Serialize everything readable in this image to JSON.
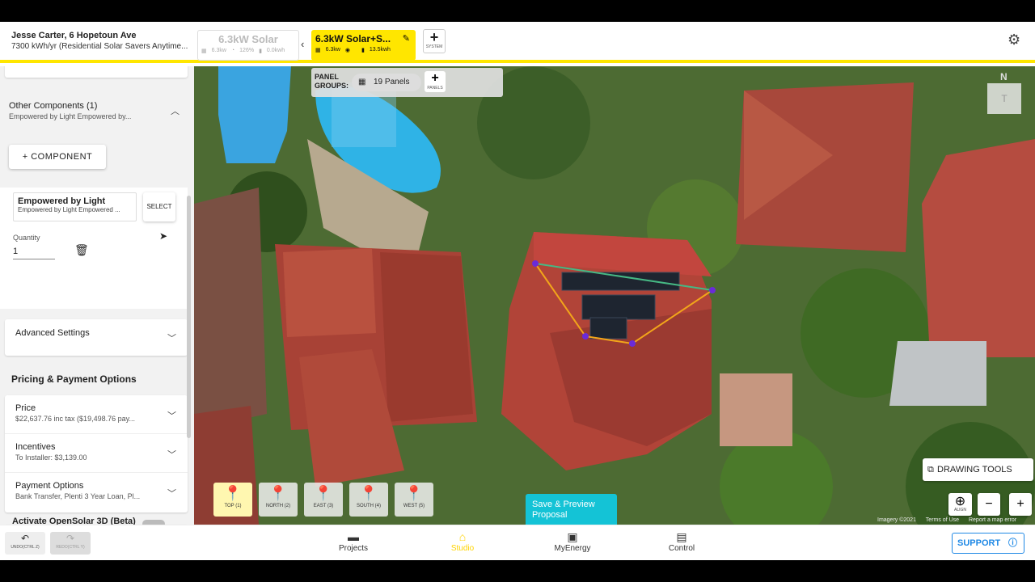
{
  "header": {
    "customer_name": "Jesse Carter, 6 Hopetoun Ave",
    "customer_usage": "7300 kWh/yr (Residential Solar Savers Anytime...",
    "system_tabs": [
      {
        "title": "6.3kW Solar",
        "stat1": "6.3kw",
        "stat2": "126%",
        "stat3": "0.0kwh"
      },
      {
        "title": "6.3kW Solar+S...",
        "stat1": "6.3kw",
        "stat2": "",
        "stat3": "13.5kwh"
      }
    ],
    "add_system_label": "SYSTEM"
  },
  "sidebar": {
    "other_components": {
      "title": "Other Components (1)",
      "subtitle": "Empowered by Light Empowered by..."
    },
    "add_component_label": "+ COMPONENT",
    "component": {
      "name": "Empowered by Light",
      "desc": "Empowered by Light Empowered ...",
      "select_label": "SELECT",
      "quantity_label": "Quantity",
      "quantity_value": "1"
    },
    "advanced_settings_label": "Advanced Settings",
    "pricing_heading": "Pricing & Payment Options",
    "price": {
      "title": "Price",
      "value": "$22,637.76 inc tax ($19,498.76 pay..."
    },
    "incentives": {
      "title": "Incentives",
      "value": "To Installer: $3,139.00"
    },
    "payment": {
      "title": "Payment Options",
      "value": "Bank Transfer, Plenti 3 Year Loan, Pl..."
    },
    "opensolar_3d_label": "Activate OpenSolar 3D (Beta)"
  },
  "map": {
    "panel_groups_label": "PANEL GROUPS:",
    "panels_chip": "19 Panels",
    "panel_add_label": "PANELS",
    "compass_n": "N",
    "compass_t": "T",
    "drawing_tools_label": "DRAWING TOOLS",
    "align_label": "ALIGN",
    "imagery": "Imagery ©2021",
    "terms": "Terms of Use",
    "report": "Report a map error",
    "views": [
      "TOP (1)",
      "NORTH (2)",
      "EAST (3)",
      "SOUTH (4)",
      "WEST (5)"
    ],
    "save_preview": "Save & Preview Proposal"
  },
  "footer": {
    "undo_label": "UNDO(CTRL Z)",
    "redo_label": "REDO(CTRL Y)",
    "nav": [
      "Projects",
      "Studio",
      "MyEnergy",
      "Control"
    ],
    "support_label": "SUPPORT"
  },
  "colors": {
    "accent": "#ffe600",
    "cta": "#14c3d6",
    "support": "#1e88e5"
  }
}
